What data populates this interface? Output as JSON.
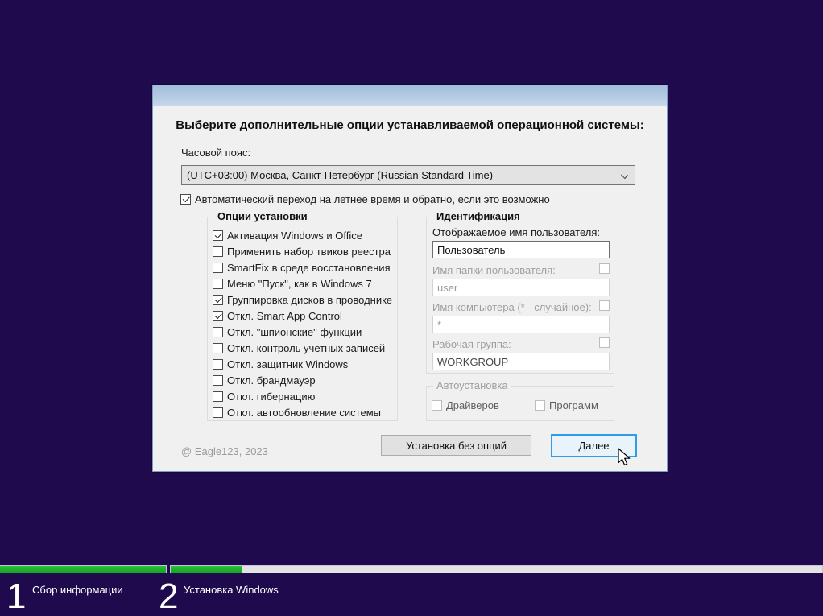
{
  "dialog": {
    "heading": "Выберите дополнительные опции устанавливаемой операционной системы:"
  },
  "timezone": {
    "label": "Часовой пояс:",
    "value": "(UTC+03:00) Москва, Санкт-Петербург (Russian Standard Time)"
  },
  "dst_checkbox": {
    "label": "Автоматический переход на летнее время и обратно, если это возможно",
    "checked": true
  },
  "install_options": {
    "title": "Опции установки",
    "items": [
      {
        "label": "Активация Windows и Office",
        "checked": true
      },
      {
        "label": "Применить набор твиков реестра",
        "checked": false
      },
      {
        "label": "SmartFix в среде восстановления",
        "checked": false
      },
      {
        "label": "Меню \"Пуск\", как в Windows 7",
        "checked": false
      },
      {
        "label": "Группировка дисков в проводнике",
        "checked": true
      },
      {
        "label": "Откл. Smart App Control",
        "checked": true
      },
      {
        "label": "Откл. \"шпионские\" функции",
        "checked": false
      },
      {
        "label": "Откл. контроль учетных записей",
        "checked": false
      },
      {
        "label": "Откл. защитник Windows",
        "checked": false
      },
      {
        "label": "Откл. брандмауэр",
        "checked": false
      },
      {
        "label": "Откл. гибернацию",
        "checked": false
      },
      {
        "label": "Откл. автообновление системы",
        "checked": false
      }
    ]
  },
  "identification": {
    "title": "Идентификация",
    "fields": [
      {
        "label": "Отображаемое имя пользователя:",
        "value": "Пользователь",
        "enabled": true,
        "has_checkbox": false,
        "checkbox_checked": false
      },
      {
        "label": "Имя папки пользователя:",
        "value": "user",
        "enabled": false,
        "has_checkbox": true,
        "checkbox_checked": false
      },
      {
        "label": "Имя компьютера (* - случайное):",
        "value": "*",
        "enabled": false,
        "has_checkbox": true,
        "checkbox_checked": false
      },
      {
        "label": "Рабочая группа:",
        "value": "WORKGROUP",
        "enabled": false,
        "has_checkbox": true,
        "checkbox_checked": false
      }
    ]
  },
  "autoinstall": {
    "title": "Автоустановка",
    "items": [
      {
        "label": "Драйверов",
        "checked": false
      },
      {
        "label": "Программ",
        "checked": false
      }
    ]
  },
  "footer": {
    "copyright": "@ Eagle123, 2023",
    "secondary_button": "Установка без опций",
    "primary_button": "Далее"
  },
  "taskbar": {
    "steps": [
      {
        "number": "1",
        "label": "Сбор информации",
        "progress": 100
      },
      {
        "number": "2",
        "label": "Установка Windows",
        "progress": 11
      }
    ]
  },
  "colors": {
    "background": "#1e0a4c",
    "dialog_bg": "#f0f0f0",
    "titlebar_top": "#a2bdda",
    "titlebar_bottom": "#c8d8ec",
    "progress_green": "#1aaf2c",
    "progress_track": "#e3e3e3",
    "primary_button_border": "#2f9ce8",
    "primary_button_bg": "#e9f3fb",
    "disabled_text": "#9a9a9a"
  }
}
